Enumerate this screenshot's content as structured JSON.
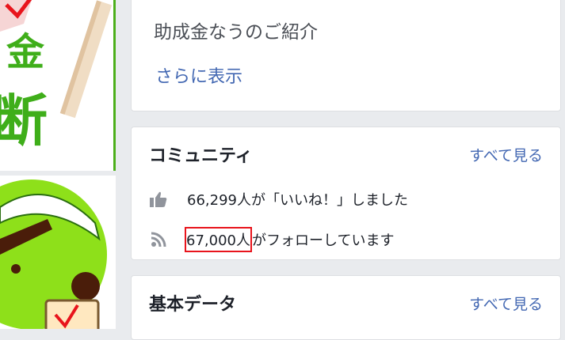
{
  "banner": {
    "text_kanji_1": "金",
    "text_kanji_2": "断"
  },
  "about_card": {
    "title": "助成金なうのご紹介",
    "more_link": "さらに表示"
  },
  "community_card": {
    "heading": "コミュニティ",
    "see_all": "すべて見る",
    "likes_text": "66,299人が「いいね！」しました",
    "follow_count": "67,000人",
    "follow_suffix": "がフォローしています",
    "likes_icon": "thumbs-up-icon",
    "follow_icon": "rss-feed-icon"
  },
  "basic_data_card": {
    "heading": "基本データ",
    "see_all": "すべて見る"
  },
  "colors": {
    "link": "#4267b2",
    "highlight": "#e8141c",
    "brand_green": "#3fae1a"
  }
}
